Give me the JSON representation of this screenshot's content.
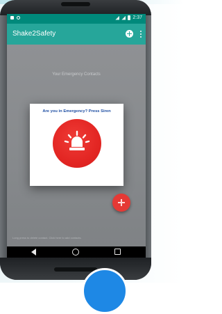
{
  "app": {
    "title": "Shake2Safety"
  },
  "status_bar": {
    "time": "2:37"
  },
  "main": {
    "contacts_heading": "Your Emergency Contacts",
    "footer_note": "Long press to delete contact. Click here to add contacts."
  },
  "dialog": {
    "title": "Are you in Emergency? Press Siren",
    "button_icon": "siren-icon"
  },
  "icons": {
    "appbar_add": "plus-circle-icon",
    "appbar_menu": "overflow-icon",
    "fab": "plus-icon",
    "nav_back": "back-icon",
    "nav_home": "home-icon",
    "nav_recents": "recents-icon"
  },
  "colors": {
    "status_bar": "#00897b",
    "app_bar": "#26a69a",
    "alert_red": "#e32623",
    "dialog_title": "#1f4fa3",
    "fab": "#e53935"
  }
}
